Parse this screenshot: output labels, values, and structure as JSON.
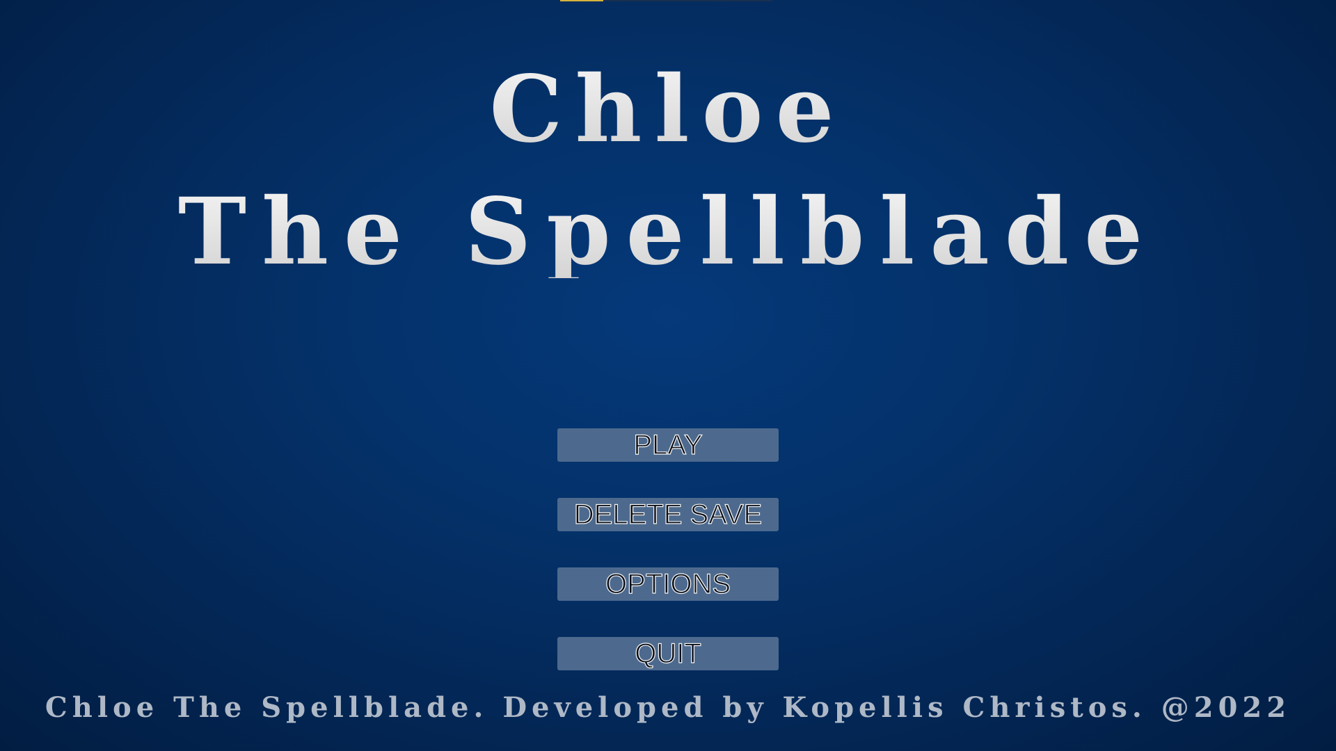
{
  "game": {
    "title_line_1": "Chloe",
    "title_line_2": "The Spellblade"
  },
  "menu": {
    "play_label": "PLAY",
    "delete_save_label": "DELETE SAVE",
    "options_label": "OPTIONS",
    "quit_label": "QUIT"
  },
  "footer": {
    "credits": "Chloe The Spellblade. Developed by Kopellis Christos. @2022"
  },
  "colors": {
    "background": "#043067",
    "button_bg": "#4d6a8e",
    "title_text": "#e6e6e6",
    "footer_text": "#aeb8c6",
    "top_bar_accent": "#d8b23a"
  }
}
